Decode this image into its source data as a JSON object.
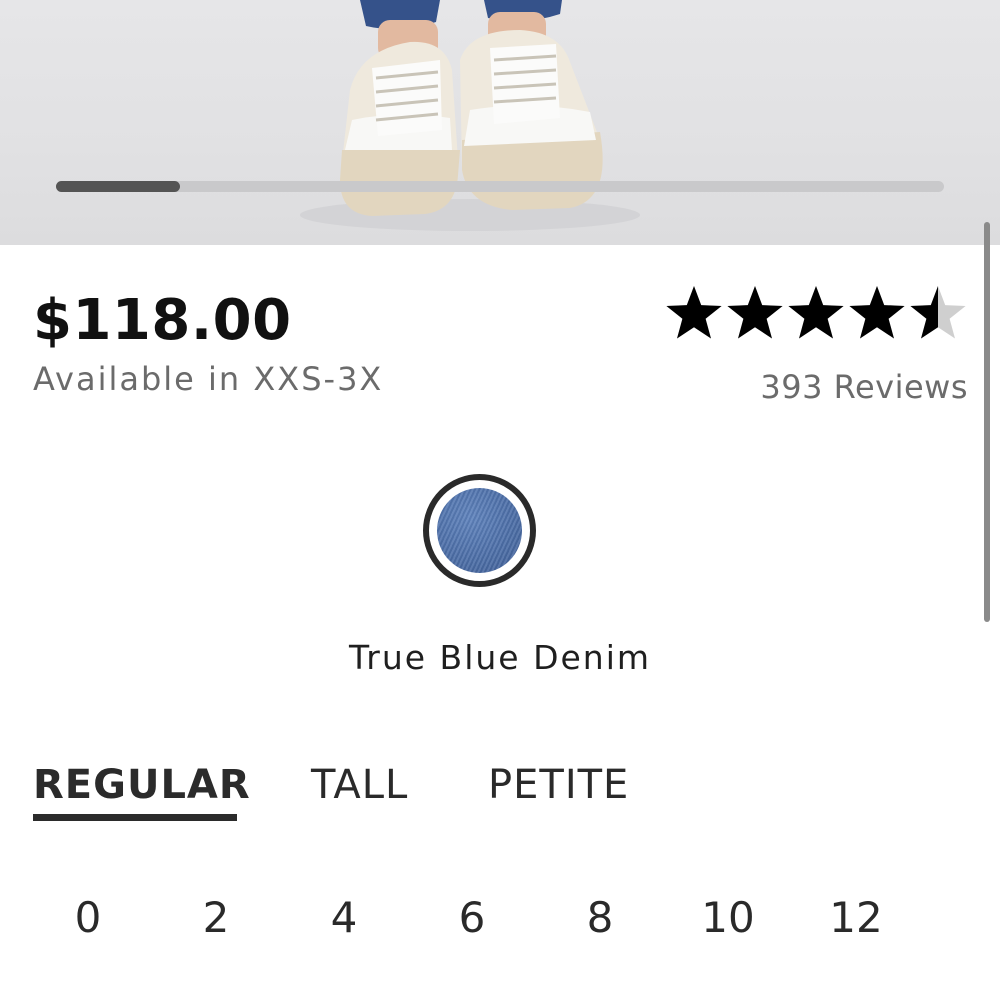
{
  "product": {
    "price": "$118.00",
    "availability": "Available in XXS-3X",
    "rating": 4.5,
    "rating_max": 5,
    "reviews_label": "393 Reviews"
  },
  "gallery": {
    "progress_fraction": 0.14
  },
  "color": {
    "name": "True Blue Denim",
    "swatch_hex": "#4d6fa8"
  },
  "fit_tabs": [
    {
      "label": "REGULAR",
      "active": true
    },
    {
      "label": "TALL",
      "active": false
    },
    {
      "label": "PETITE",
      "active": false
    }
  ],
  "sizes": [
    "0",
    "2",
    "4",
    "6",
    "8",
    "10",
    "12"
  ],
  "colors": {
    "text": "#1a1a1a",
    "muted": "#6b6b6b",
    "star_filled": "#000000",
    "star_empty": "#cfcfcf"
  }
}
